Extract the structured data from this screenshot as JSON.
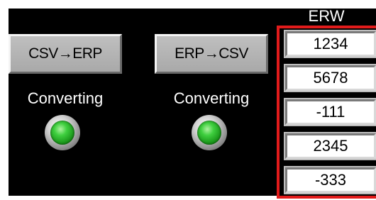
{
  "buttons": {
    "csv_to_erp": "CSV→ERP",
    "erp_to_csv": "ERP→CSV"
  },
  "status": {
    "left_label": "Converting",
    "right_label": "Converting",
    "lamp_color": "#2fbf2f"
  },
  "erw": {
    "header": "ERW",
    "frame_color": "#e11b1b",
    "values": [
      "1234",
      "5678",
      "-111",
      "2345",
      "-333"
    ]
  }
}
